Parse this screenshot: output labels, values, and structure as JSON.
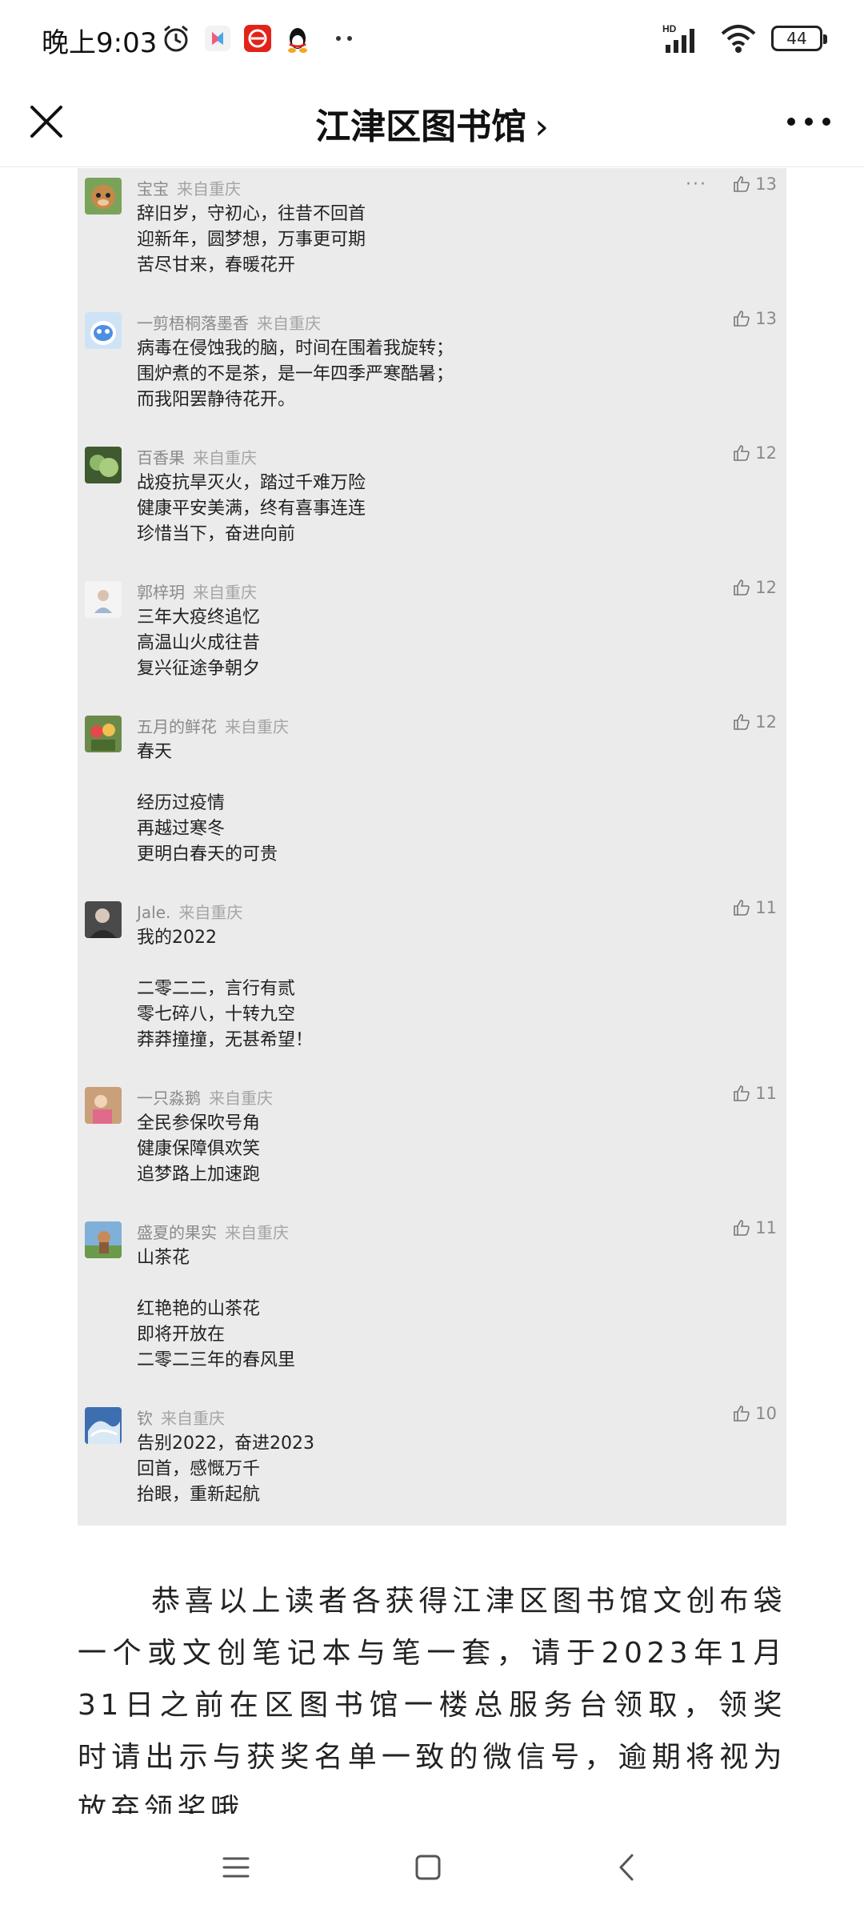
{
  "status_bar": {
    "time": "晚上9:03",
    "network": "HD",
    "battery": "44"
  },
  "nav": {
    "title": "江津区图书馆",
    "chevron": "›"
  },
  "comments": [
    {
      "name": "宝宝",
      "from": "来自重庆",
      "text": "辞旧岁，守初心，往昔不回首\n迎新年，圆梦想，万事更可期\n苦尽甘来，春暖花开",
      "likes": "13",
      "more": "···"
    },
    {
      "name": "一剪梧桐落墨香",
      "from": "来自重庆",
      "text": "病毒在侵蚀我的脑，时间在围着我旋转；\n围炉煮的不是茶，是一年四季严寒酷暑；\n而我阳罢静待花开。",
      "likes": "13"
    },
    {
      "name": "百香果",
      "from": "来自重庆",
      "text": "战疫抗旱灭火，踏过千难万险\n健康平安美满，终有喜事连连\n珍惜当下，奋进向前",
      "likes": "12"
    },
    {
      "name": "郭梓玥",
      "from": "来自重庆",
      "text": "三年大疫终追忆\n高温山火成往昔\n复兴征途争朝夕",
      "likes": "12"
    },
    {
      "name": "五月的鲜花",
      "from": "来自重庆",
      "text": "春天\n\n经历过疫情\n再越过寒冬\n更明白春天的可贵",
      "likes": "12"
    },
    {
      "name": "Jale.",
      "from": "来自重庆",
      "text": "我的2022\n\n二零二二，言行有贰\n零七碎八，十转九空\n莽莽撞撞，无甚希望！",
      "likes": "11"
    },
    {
      "name": "一只淼鹅",
      "from": "来自重庆",
      "text": "全民参保吹号角\n健康保障俱欢笑\n追梦路上加速跑",
      "likes": "11"
    },
    {
      "name": "盛夏的果实",
      "from": "来自重庆",
      "text": "山茶花\n\n红艳艳的山茶花\n即将开放在\n二零二三年的春风里",
      "likes": "11"
    },
    {
      "name": "钦",
      "from": "来自重庆",
      "text": "告别2022，奋进2023\n回首，感慨万千\n抬眼，重新起航",
      "likes": "10"
    }
  ],
  "article": {
    "paragraph": "恭喜以上读者各获得江津区图书馆文创布袋一个或文创笔记本与笔一套，请于2023年1月31日之前在区图书馆一楼总服务台领取，领奖时请出示与获奖名单一致的微信号，逾期将视为放弃领奖哦"
  }
}
